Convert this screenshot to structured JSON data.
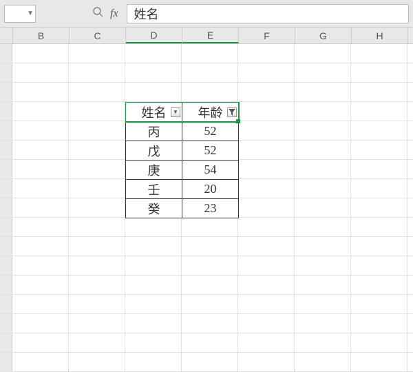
{
  "formula_bar": {
    "name_box": "",
    "formula": "姓名"
  },
  "columns": [
    "B",
    "C",
    "D",
    "E",
    "F",
    "G",
    "H"
  ],
  "selected_columns": [
    "D",
    "E"
  ],
  "table": {
    "headers": {
      "name": "姓名",
      "age": "年龄"
    },
    "rows": [
      {
        "name": "丙",
        "age": "52"
      },
      {
        "name": "戊",
        "age": "52"
      },
      {
        "name": "庚",
        "age": "54"
      },
      {
        "name": "壬",
        "age": "20"
      },
      {
        "name": "癸",
        "age": "23"
      }
    ]
  },
  "chart_data": {
    "type": "table",
    "title": "",
    "columns": [
      "姓名",
      "年龄"
    ],
    "rows": [
      [
        "丙",
        52
      ],
      [
        "戊",
        52
      ],
      [
        "庚",
        54
      ],
      [
        "壬",
        20
      ],
      [
        "癸",
        23
      ]
    ]
  }
}
